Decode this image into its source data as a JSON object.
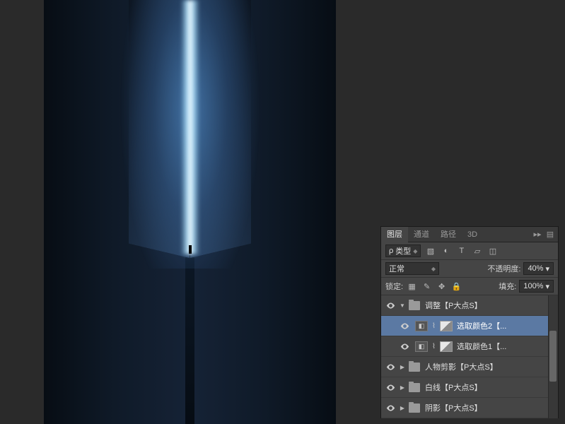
{
  "tabs": {
    "active": "图层",
    "channels": "通道",
    "paths": "路径",
    "threeD": "3D"
  },
  "filter": {
    "kind": "类型",
    "search": "ρ"
  },
  "blend": {
    "mode": "正常",
    "opacityLabel": "不透明度:",
    "opacityValue": "40%"
  },
  "lock": {
    "label": "锁定:",
    "fillLabel": "填充:",
    "fillValue": "100%"
  },
  "layers": [
    {
      "type": "group",
      "name": "调整【P大点S】",
      "expanded": true
    },
    {
      "type": "adj",
      "name": "选取颜色2【...",
      "selected": true,
      "indent": 1
    },
    {
      "type": "adj",
      "name": "选取颜色1【...",
      "indent": 1
    },
    {
      "type": "group",
      "name": "人物剪影【P大点S】",
      "expanded": false
    },
    {
      "type": "group",
      "name": "白线【P大点S】",
      "expanded": false
    },
    {
      "type": "group",
      "name": "阴影【P大点S】",
      "expanded": false
    }
  ]
}
